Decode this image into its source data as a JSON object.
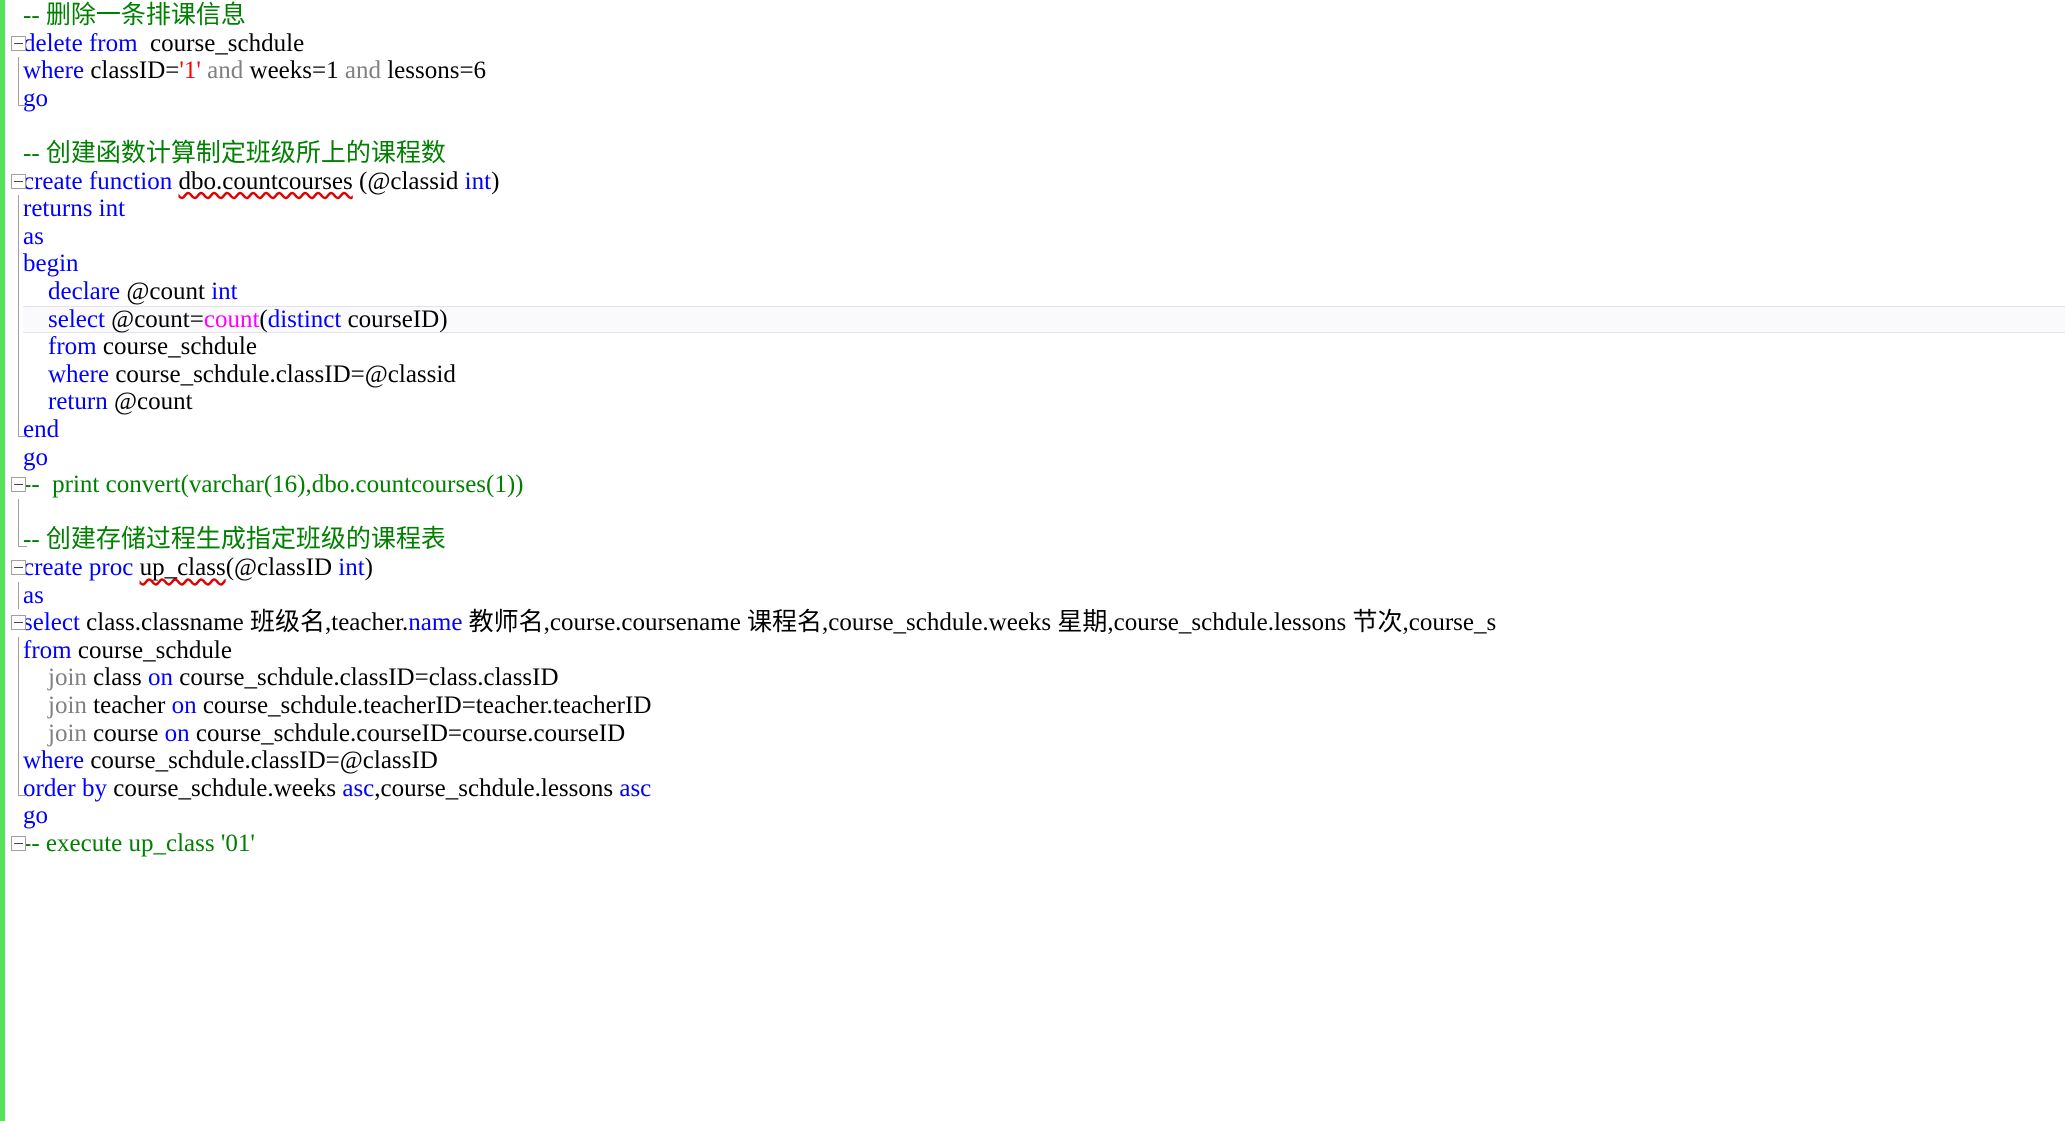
{
  "app": {
    "kind": "sql-code-editor",
    "language": "T-SQL"
  },
  "colors": {
    "background": "#ffffff",
    "keyword": "#0000ff",
    "comment": "#008000",
    "string": "#ff0000",
    "function": "#ff00ff",
    "operator_keyword": "#808080",
    "plain_text": "#000000",
    "change_bar": "#56e156",
    "current_line_background": "#fafafc",
    "current_line_border": "#e3e3ec",
    "squiggle": "#e00000",
    "outline_glyph": "#a0a0a0"
  },
  "gutter": {
    "collapse_icon_name": "collapse-minus-box",
    "change_bar_name": "unsaved-change-indicator"
  },
  "code": {
    "lines": [
      {
        "n": 1,
        "outline": "none",
        "current": false,
        "tokens": [
          {
            "t": "cmt",
            "v": "-- 删除一条排课信息"
          }
        ]
      },
      {
        "n": 2,
        "outline": "collapse",
        "current": false,
        "tokens": [
          {
            "t": "kw",
            "v": "delete"
          },
          {
            "t": "plain",
            "v": " "
          },
          {
            "t": "kw",
            "v": "from"
          },
          {
            "t": "plain",
            "v": "  course_schdule"
          }
        ]
      },
      {
        "n": 3,
        "outline": "region",
        "current": false,
        "tokens": [
          {
            "t": "kw",
            "v": "where"
          },
          {
            "t": "plain",
            "v": " classID="
          },
          {
            "t": "str",
            "v": "'1'"
          },
          {
            "t": "plain",
            "v": " "
          },
          {
            "t": "gray",
            "v": "and"
          },
          {
            "t": "plain",
            "v": " weeks=1 "
          },
          {
            "t": "gray",
            "v": "and"
          },
          {
            "t": "plain",
            "v": " lessons=6"
          }
        ]
      },
      {
        "n": 4,
        "outline": "foot",
        "current": false,
        "tokens": [
          {
            "t": "kw",
            "v": "go"
          }
        ]
      },
      {
        "n": 5,
        "outline": "none",
        "current": false,
        "tokens": [
          {
            "t": "plain",
            "v": ""
          }
        ]
      },
      {
        "n": 6,
        "outline": "none",
        "current": false,
        "tokens": [
          {
            "t": "cmt",
            "v": "-- 创建函数计算制定班级所上的课程数"
          }
        ]
      },
      {
        "n": 7,
        "outline": "collapse",
        "current": false,
        "tokens": [
          {
            "t": "kw",
            "v": "create"
          },
          {
            "t": "plain",
            "v": " "
          },
          {
            "t": "kw",
            "v": "function"
          },
          {
            "t": "plain",
            "v": " "
          },
          {
            "t": "plain sq",
            "v": "dbo.countcourses"
          },
          {
            "t": "plain",
            "v": " (@classid "
          },
          {
            "t": "kw",
            "v": "int"
          },
          {
            "t": "plain",
            "v": ")"
          }
        ]
      },
      {
        "n": 8,
        "outline": "region",
        "current": false,
        "tokens": [
          {
            "t": "kw",
            "v": "returns"
          },
          {
            "t": "plain",
            "v": " "
          },
          {
            "t": "kw",
            "v": "int"
          }
        ]
      },
      {
        "n": 9,
        "outline": "region",
        "current": false,
        "tokens": [
          {
            "t": "kw",
            "v": "as"
          }
        ]
      },
      {
        "n": 10,
        "outline": "region",
        "current": false,
        "tokens": [
          {
            "t": "kw",
            "v": "begin"
          }
        ]
      },
      {
        "n": 11,
        "outline": "region",
        "current": false,
        "tokens": [
          {
            "t": "plain",
            "v": "    "
          },
          {
            "t": "kw",
            "v": "declare"
          },
          {
            "t": "plain",
            "v": " @count "
          },
          {
            "t": "kw",
            "v": "int"
          }
        ]
      },
      {
        "n": 12,
        "outline": "region",
        "current": true,
        "tokens": [
          {
            "t": "plain",
            "v": "    "
          },
          {
            "t": "kw",
            "v": "select"
          },
          {
            "t": "plain",
            "v": " @count="
          },
          {
            "t": "fn",
            "v": "count"
          },
          {
            "t": "plain",
            "v": "("
          },
          {
            "t": "kw",
            "v": "distinct"
          },
          {
            "t": "plain",
            "v": " courseID)"
          }
        ]
      },
      {
        "n": 13,
        "outline": "region",
        "current": false,
        "tokens": [
          {
            "t": "plain",
            "v": "    "
          },
          {
            "t": "kw",
            "v": "from"
          },
          {
            "t": "plain",
            "v": " course_schdule"
          }
        ]
      },
      {
        "n": 14,
        "outline": "region",
        "current": false,
        "tokens": [
          {
            "t": "plain",
            "v": "    "
          },
          {
            "t": "kw",
            "v": "where"
          },
          {
            "t": "plain",
            "v": " course_schdule.classID=@classid"
          }
        ]
      },
      {
        "n": 15,
        "outline": "region",
        "current": false,
        "tokens": [
          {
            "t": "plain",
            "v": "    "
          },
          {
            "t": "kw",
            "v": "return"
          },
          {
            "t": "plain",
            "v": " @count"
          }
        ]
      },
      {
        "n": 16,
        "outline": "foot",
        "current": false,
        "tokens": [
          {
            "t": "kw",
            "v": "end"
          }
        ]
      },
      {
        "n": 17,
        "outline": "none",
        "current": false,
        "tokens": [
          {
            "t": "kw",
            "v": "go"
          }
        ]
      },
      {
        "n": 18,
        "outline": "collapse",
        "current": false,
        "tokens": [
          {
            "t": "cmt",
            "v": "--  print convert(varchar(16),dbo.countcourses(1))"
          }
        ]
      },
      {
        "n": 19,
        "outline": "region",
        "current": false,
        "tokens": [
          {
            "t": "plain",
            "v": ""
          }
        ]
      },
      {
        "n": 20,
        "outline": "foot",
        "current": false,
        "tokens": [
          {
            "t": "cmt",
            "v": "-- 创建存储过程生成指定班级的课程表"
          }
        ]
      },
      {
        "n": 21,
        "outline": "collapse",
        "current": false,
        "tokens": [
          {
            "t": "kw",
            "v": "create"
          },
          {
            "t": "plain",
            "v": " "
          },
          {
            "t": "kw",
            "v": "proc"
          },
          {
            "t": "plain",
            "v": " "
          },
          {
            "t": "plain sq",
            "v": "up_class"
          },
          {
            "t": "plain",
            "v": "(@classID "
          },
          {
            "t": "kw",
            "v": "int"
          },
          {
            "t": "plain",
            "v": ")"
          }
        ]
      },
      {
        "n": 22,
        "outline": "region",
        "current": false,
        "tokens": [
          {
            "t": "kw",
            "v": "as"
          }
        ]
      },
      {
        "n": 23,
        "outline": "collapse",
        "current": false,
        "tokens": [
          {
            "t": "kw",
            "v": "select"
          },
          {
            "t": "plain",
            "v": " class.classname 班级名,teacher."
          },
          {
            "t": "kw",
            "v": "name"
          },
          {
            "t": "plain",
            "v": " 教师名,course.coursename 课程名,course_schdule.weeks 星期,course_schdule.lessons 节次,course_s"
          }
        ]
      },
      {
        "n": 24,
        "outline": "region",
        "current": false,
        "tokens": [
          {
            "t": "kw",
            "v": "from"
          },
          {
            "t": "plain",
            "v": " course_schdule"
          }
        ]
      },
      {
        "n": 25,
        "outline": "region",
        "current": false,
        "tokens": [
          {
            "t": "plain",
            "v": "    "
          },
          {
            "t": "gray",
            "v": "join"
          },
          {
            "t": "plain",
            "v": " class "
          },
          {
            "t": "kw",
            "v": "on"
          },
          {
            "t": "plain",
            "v": " course_schdule.classID=class.classID"
          }
        ]
      },
      {
        "n": 26,
        "outline": "region",
        "current": false,
        "tokens": [
          {
            "t": "plain",
            "v": "    "
          },
          {
            "t": "gray",
            "v": "join"
          },
          {
            "t": "plain",
            "v": " teacher "
          },
          {
            "t": "kw",
            "v": "on"
          },
          {
            "t": "plain",
            "v": " course_schdule.teacherID=teacher.teacherID"
          }
        ]
      },
      {
        "n": 27,
        "outline": "region",
        "current": false,
        "tokens": [
          {
            "t": "plain",
            "v": "    "
          },
          {
            "t": "gray",
            "v": "join"
          },
          {
            "t": "plain",
            "v": " course "
          },
          {
            "t": "kw",
            "v": "on"
          },
          {
            "t": "plain",
            "v": " course_schdule.courseID=course.courseID"
          }
        ]
      },
      {
        "n": 28,
        "outline": "region",
        "current": false,
        "tokens": [
          {
            "t": "kw",
            "v": "where"
          },
          {
            "t": "plain",
            "v": " course_schdule.classID=@classID"
          }
        ]
      },
      {
        "n": 29,
        "outline": "foot",
        "current": false,
        "tokens": [
          {
            "t": "kw",
            "v": "order"
          },
          {
            "t": "plain",
            "v": " "
          },
          {
            "t": "kw",
            "v": "by"
          },
          {
            "t": "plain",
            "v": " course_schdule.weeks "
          },
          {
            "t": "kw",
            "v": "asc"
          },
          {
            "t": "plain",
            "v": ",course_schdule.lessons "
          },
          {
            "t": "kw",
            "v": "asc"
          }
        ]
      },
      {
        "n": 30,
        "outline": "none",
        "current": false,
        "tokens": [
          {
            "t": "kw",
            "v": "go"
          }
        ]
      },
      {
        "n": 31,
        "outline": "collapse",
        "current": false,
        "tokens": [
          {
            "t": "cmt",
            "v": "-- execute up_class '01'"
          }
        ]
      }
    ],
    "full_text": "-- 删除一条排课信息\ndelete from  course_schdule\nwhere classID='1' and weeks=1 and lessons=6\ngo\n\n-- 创建函数计算制定班级所上的课程数\ncreate function dbo.countcourses (@classid int)\nreturns int\nas\nbegin\n    declare @count int\n    select @count=count(distinct courseID)\n    from course_schdule\n    where course_schdule.classID=@classid\n    return @count\nend\ngo\n--  print convert(varchar(16),dbo.countcourses(1))\n\n-- 创建存储过程生成指定班级的课程表\ncreate proc up_class(@classID int)\nas\nselect class.classname 班级名,teacher.name 教师名,course.coursename 课程名,course_schdule.weeks 星期,course_schdule.lessons 节次,course_s\nfrom course_schdule\n    join class on course_schdule.classID=class.classID\n    join teacher on course_schdule.teacherID=teacher.teacherID\n    join course on course_schdule.courseID=course.courseID\nwhere course_schdule.classID=@classID\norder by course_schdule.weeks asc,course_schdule.lessons asc\ngo\n-- execute up_class '01'"
  }
}
